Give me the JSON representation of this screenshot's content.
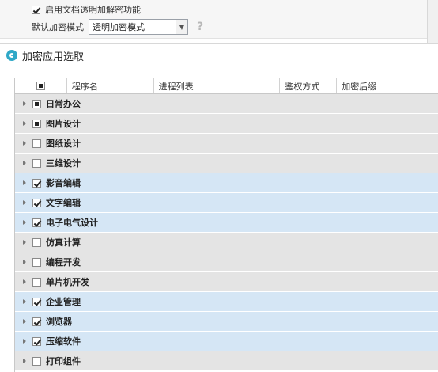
{
  "settings": {
    "enable_label": "启用文档透明加解密功能",
    "enable_checked": true,
    "mode_label": "默认加密模式",
    "mode_value": "透明加密模式",
    "help_glyph": "?"
  },
  "dialog": {
    "title": "加密应用选取"
  },
  "table": {
    "columns": [
      "程序名",
      "进程列表",
      "鉴权方式",
      "加密后缀"
    ],
    "rows": [
      {
        "label": "日常办公",
        "state": "partial"
      },
      {
        "label": "图片设计",
        "state": "partial"
      },
      {
        "label": "图纸设计",
        "state": "unchecked"
      },
      {
        "label": "三维设计",
        "state": "unchecked"
      },
      {
        "label": "影音编辑",
        "state": "checked"
      },
      {
        "label": "文字编辑",
        "state": "checked"
      },
      {
        "label": "电子电气设计",
        "state": "checked"
      },
      {
        "label": "仿真计算",
        "state": "unchecked"
      },
      {
        "label": "编程开发",
        "state": "unchecked"
      },
      {
        "label": "单片机开发",
        "state": "unchecked"
      },
      {
        "label": "企业管理",
        "state": "checked"
      },
      {
        "label": "浏览器",
        "state": "checked"
      },
      {
        "label": "压缩软件",
        "state": "checked"
      },
      {
        "label": "打印组件",
        "state": "unchecked"
      }
    ]
  },
  "colors": {
    "row_default": "#e4e4e4",
    "row_checked": "#d5e6f5",
    "accent_icon": "#2fa8c7"
  },
  "icons": {
    "dialog_icon": "refresh-circle-icon",
    "expander": "triangle-right-icon",
    "dropdown": "chevron-down-icon",
    "help": "question-mark-icon"
  }
}
